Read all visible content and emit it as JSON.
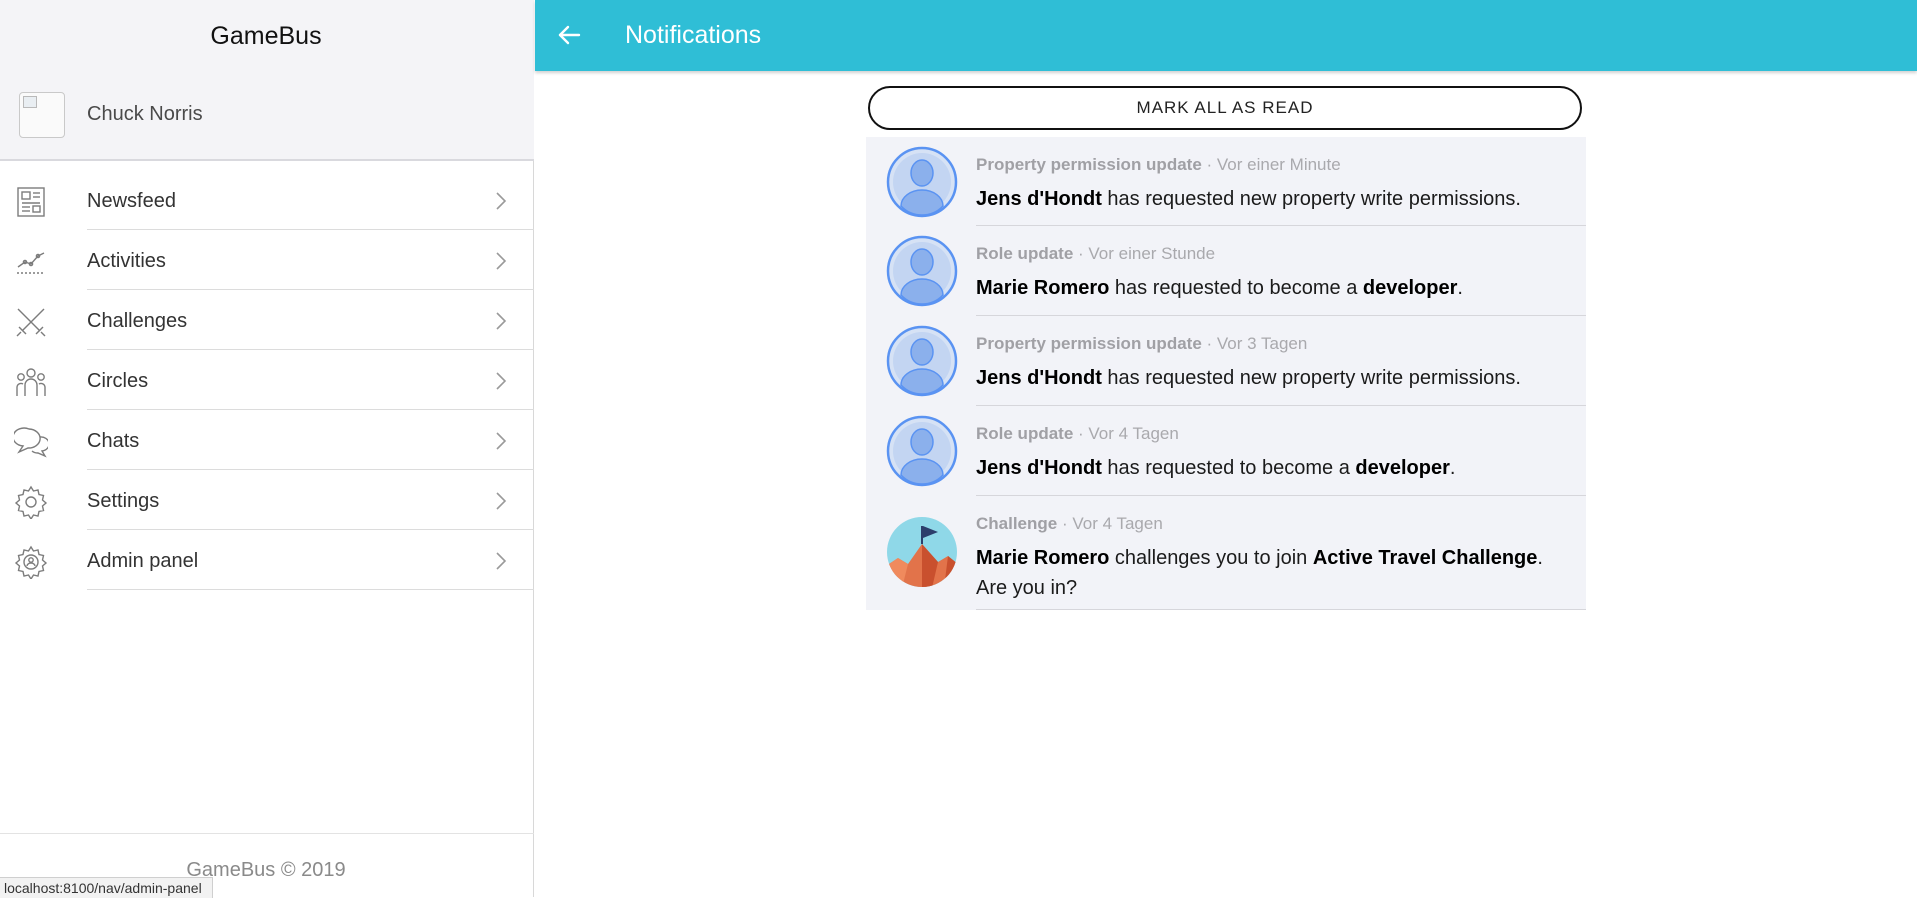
{
  "app": {
    "title": "GameBus",
    "copyright": "GameBus © 2019"
  },
  "user": {
    "name": "Chuck Norris"
  },
  "menu": [
    {
      "label": "Newsfeed",
      "icon": "newspaper-icon"
    },
    {
      "label": "Activities",
      "icon": "activity-chart-icon"
    },
    {
      "label": "Challenges",
      "icon": "crossed-swords-icon"
    },
    {
      "label": "Circles",
      "icon": "group-icon"
    },
    {
      "label": "Chats",
      "icon": "chat-bubbles-icon"
    },
    {
      "label": "Settings",
      "icon": "gear-icon"
    },
    {
      "label": "Admin panel",
      "icon": "admin-gear-icon"
    }
  ],
  "status_url": "localhost:8100/nav/admin-panel",
  "header": {
    "title": "Notifications",
    "back_icon": "arrow-left-icon"
  },
  "mark_all_read": "MARK ALL AS READ",
  "notifications": [
    {
      "type": "Property permission update",
      "sep": " · ",
      "time": "Vor einer Minute",
      "actor": "Jens d'Hondt",
      "text": " has requested new property write permissions.",
      "obj": "",
      "end": "",
      "avatar": "user-silhouette-icon"
    },
    {
      "type": "Role update",
      "sep": " · ",
      "time": "Vor einer Stunde",
      "actor": "Marie Romero",
      "text": " has requested to become a ",
      "obj": "developer",
      "end": ".",
      "avatar": "user-silhouette-icon"
    },
    {
      "type": "Property permission update",
      "sep": " · ",
      "time": "Vor 3 Tagen",
      "actor": "Jens d'Hondt",
      "text": " has requested new property write permissions.",
      "obj": "",
      "end": "",
      "avatar": "user-silhouette-icon"
    },
    {
      "type": "Role update",
      "sep": " · ",
      "time": "Vor 4 Tagen",
      "actor": "Jens d'Hondt",
      "text": " has requested to become a ",
      "obj": "developer",
      "end": ".",
      "avatar": "user-silhouette-icon"
    },
    {
      "type": "Challenge",
      "sep": " · ",
      "time": "Vor 4 Tagen",
      "actor": "Marie Romero",
      "text": " challenges you to join ",
      "obj": "Active Travel Challenge",
      "end": ". Are you in?",
      "avatar": "mountain-flag-icon"
    }
  ],
  "colors": {
    "accent": "#2fbed6",
    "item_bg": "#f2f3f8",
    "avatar_blue": "#5a93f2"
  }
}
